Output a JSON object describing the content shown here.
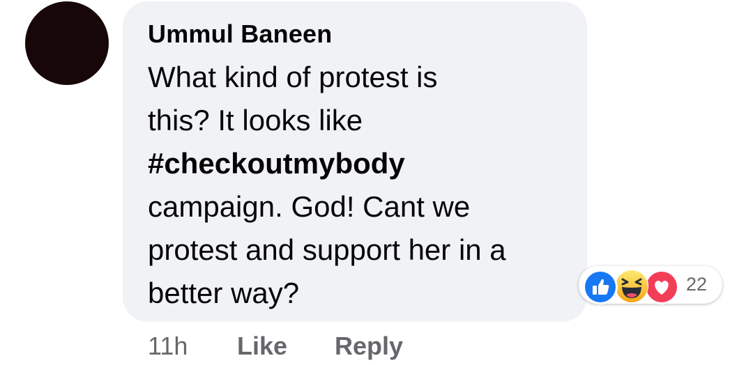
{
  "comment": {
    "author": "Ummul Baneen",
    "lines": [
      "What kind of protest is",
      "this? It looks like",
      "#checkoutmybody",
      "campaign. God! Cant we",
      "protest and support her in a",
      "better way?"
    ]
  },
  "reactions": {
    "icons": [
      "like-icon",
      "haha-icon",
      "love-icon"
    ],
    "count": "22"
  },
  "actions": {
    "time": "11h",
    "like_label": "Like",
    "reply_label": "Reply"
  },
  "colors": {
    "bubble": "#f0f2f5",
    "like_blue": "#1877f2",
    "love_red": "#f33e58",
    "haha_yellow": "#f7b125",
    "meta_gray": "#65676b",
    "text": "#050505"
  }
}
